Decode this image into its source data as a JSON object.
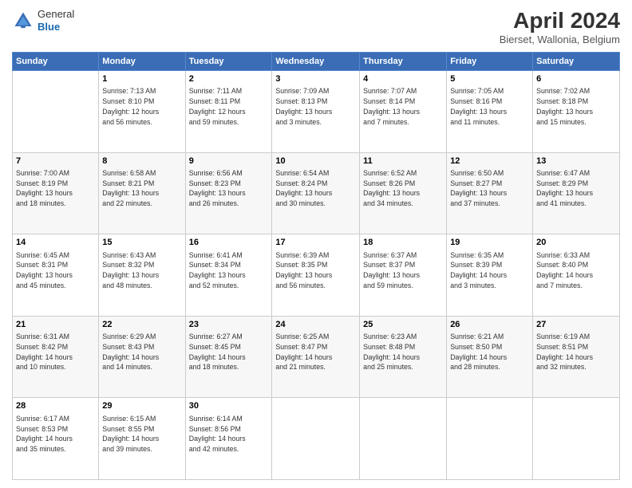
{
  "logo": {
    "general": "General",
    "blue": "Blue"
  },
  "title": "April 2024",
  "subtitle": "Bierset, Wallonia, Belgium",
  "headers": [
    "Sunday",
    "Monday",
    "Tuesday",
    "Wednesday",
    "Thursday",
    "Friday",
    "Saturday"
  ],
  "weeks": [
    [
      {
        "day": "",
        "info": ""
      },
      {
        "day": "1",
        "info": "Sunrise: 7:13 AM\nSunset: 8:10 PM\nDaylight: 12 hours\nand 56 minutes."
      },
      {
        "day": "2",
        "info": "Sunrise: 7:11 AM\nSunset: 8:11 PM\nDaylight: 12 hours\nand 59 minutes."
      },
      {
        "day": "3",
        "info": "Sunrise: 7:09 AM\nSunset: 8:13 PM\nDaylight: 13 hours\nand 3 minutes."
      },
      {
        "day": "4",
        "info": "Sunrise: 7:07 AM\nSunset: 8:14 PM\nDaylight: 13 hours\nand 7 minutes."
      },
      {
        "day": "5",
        "info": "Sunrise: 7:05 AM\nSunset: 8:16 PM\nDaylight: 13 hours\nand 11 minutes."
      },
      {
        "day": "6",
        "info": "Sunrise: 7:02 AM\nSunset: 8:18 PM\nDaylight: 13 hours\nand 15 minutes."
      }
    ],
    [
      {
        "day": "7",
        "info": "Sunrise: 7:00 AM\nSunset: 8:19 PM\nDaylight: 13 hours\nand 18 minutes."
      },
      {
        "day": "8",
        "info": "Sunrise: 6:58 AM\nSunset: 8:21 PM\nDaylight: 13 hours\nand 22 minutes."
      },
      {
        "day": "9",
        "info": "Sunrise: 6:56 AM\nSunset: 8:23 PM\nDaylight: 13 hours\nand 26 minutes."
      },
      {
        "day": "10",
        "info": "Sunrise: 6:54 AM\nSunset: 8:24 PM\nDaylight: 13 hours\nand 30 minutes."
      },
      {
        "day": "11",
        "info": "Sunrise: 6:52 AM\nSunset: 8:26 PM\nDaylight: 13 hours\nand 34 minutes."
      },
      {
        "day": "12",
        "info": "Sunrise: 6:50 AM\nSunset: 8:27 PM\nDaylight: 13 hours\nand 37 minutes."
      },
      {
        "day": "13",
        "info": "Sunrise: 6:47 AM\nSunset: 8:29 PM\nDaylight: 13 hours\nand 41 minutes."
      }
    ],
    [
      {
        "day": "14",
        "info": "Sunrise: 6:45 AM\nSunset: 8:31 PM\nDaylight: 13 hours\nand 45 minutes."
      },
      {
        "day": "15",
        "info": "Sunrise: 6:43 AM\nSunset: 8:32 PM\nDaylight: 13 hours\nand 48 minutes."
      },
      {
        "day": "16",
        "info": "Sunrise: 6:41 AM\nSunset: 8:34 PM\nDaylight: 13 hours\nand 52 minutes."
      },
      {
        "day": "17",
        "info": "Sunrise: 6:39 AM\nSunset: 8:35 PM\nDaylight: 13 hours\nand 56 minutes."
      },
      {
        "day": "18",
        "info": "Sunrise: 6:37 AM\nSunset: 8:37 PM\nDaylight: 13 hours\nand 59 minutes."
      },
      {
        "day": "19",
        "info": "Sunrise: 6:35 AM\nSunset: 8:39 PM\nDaylight: 14 hours\nand 3 minutes."
      },
      {
        "day": "20",
        "info": "Sunrise: 6:33 AM\nSunset: 8:40 PM\nDaylight: 14 hours\nand 7 minutes."
      }
    ],
    [
      {
        "day": "21",
        "info": "Sunrise: 6:31 AM\nSunset: 8:42 PM\nDaylight: 14 hours\nand 10 minutes."
      },
      {
        "day": "22",
        "info": "Sunrise: 6:29 AM\nSunset: 8:43 PM\nDaylight: 14 hours\nand 14 minutes."
      },
      {
        "day": "23",
        "info": "Sunrise: 6:27 AM\nSunset: 8:45 PM\nDaylight: 14 hours\nand 18 minutes."
      },
      {
        "day": "24",
        "info": "Sunrise: 6:25 AM\nSunset: 8:47 PM\nDaylight: 14 hours\nand 21 minutes."
      },
      {
        "day": "25",
        "info": "Sunrise: 6:23 AM\nSunset: 8:48 PM\nDaylight: 14 hours\nand 25 minutes."
      },
      {
        "day": "26",
        "info": "Sunrise: 6:21 AM\nSunset: 8:50 PM\nDaylight: 14 hours\nand 28 minutes."
      },
      {
        "day": "27",
        "info": "Sunrise: 6:19 AM\nSunset: 8:51 PM\nDaylight: 14 hours\nand 32 minutes."
      }
    ],
    [
      {
        "day": "28",
        "info": "Sunrise: 6:17 AM\nSunset: 8:53 PM\nDaylight: 14 hours\nand 35 minutes."
      },
      {
        "day": "29",
        "info": "Sunrise: 6:15 AM\nSunset: 8:55 PM\nDaylight: 14 hours\nand 39 minutes."
      },
      {
        "day": "30",
        "info": "Sunrise: 6:14 AM\nSunset: 8:56 PM\nDaylight: 14 hours\nand 42 minutes."
      },
      {
        "day": "",
        "info": ""
      },
      {
        "day": "",
        "info": ""
      },
      {
        "day": "",
        "info": ""
      },
      {
        "day": "",
        "info": ""
      }
    ]
  ]
}
